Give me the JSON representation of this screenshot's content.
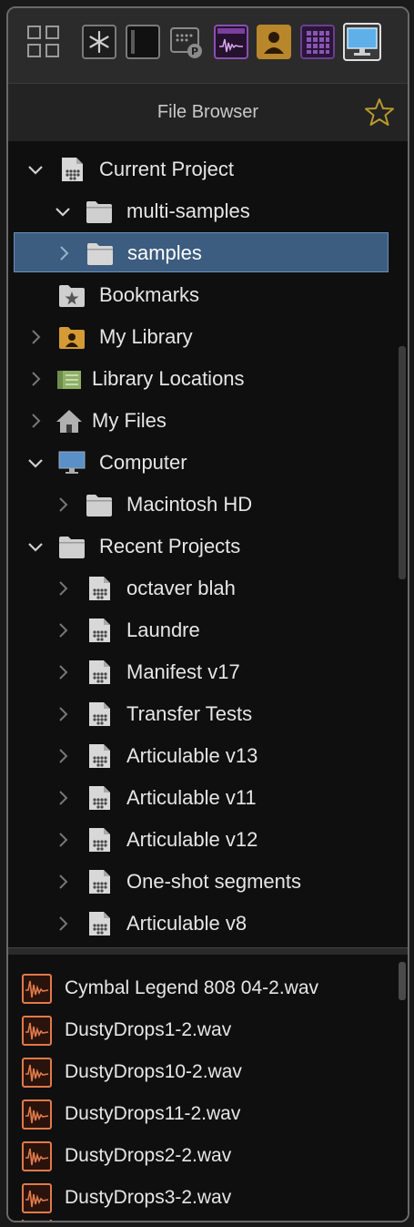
{
  "panel": {
    "title": "File Browser"
  },
  "toolbar": {
    "buttons": [
      {
        "name": "grid-icon"
      },
      {
        "name": "asterisk-icon"
      },
      {
        "name": "panel-icon"
      },
      {
        "name": "keypad-p-icon"
      },
      {
        "name": "waveform-icon"
      },
      {
        "name": "user-icon"
      },
      {
        "name": "pad-grid-icon"
      },
      {
        "name": "monitor-icon"
      }
    ]
  },
  "tree": {
    "items": [
      {
        "label": "Current Project",
        "level": 0,
        "expanded": true,
        "has_chevron": true,
        "icon": "project-icon"
      },
      {
        "label": "multi-samples",
        "level": 1,
        "expanded": true,
        "has_chevron": true,
        "icon": "folder-icon"
      },
      {
        "label": "samples",
        "level": 1,
        "expanded": false,
        "has_chevron": true,
        "icon": "folder-icon",
        "selected": true
      },
      {
        "label": "Bookmarks",
        "level": 0,
        "has_chevron": false,
        "icon": "bookmark-folder-icon"
      },
      {
        "label": "My Library",
        "level": 0,
        "expanded": false,
        "has_chevron": true,
        "icon": "library-user-icon"
      },
      {
        "label": "Library Locations",
        "level": 0,
        "expanded": false,
        "has_chevron": true,
        "icon": "library-locations-icon"
      },
      {
        "label": "My Files",
        "level": 0,
        "expanded": false,
        "has_chevron": true,
        "icon": "home-icon"
      },
      {
        "label": "Computer",
        "level": 0,
        "expanded": true,
        "has_chevron": true,
        "icon": "monitor-icon"
      },
      {
        "label": "Macintosh HD",
        "level": 1,
        "expanded": false,
        "has_chevron": true,
        "icon": "folder-icon"
      },
      {
        "label": "Recent Projects",
        "level": 0,
        "expanded": true,
        "has_chevron": true,
        "icon": "folder-icon"
      },
      {
        "label": "octaver blah",
        "level": 1,
        "expanded": false,
        "has_chevron": true,
        "icon": "project-icon"
      },
      {
        "label": "Laundre",
        "level": 1,
        "expanded": false,
        "has_chevron": true,
        "icon": "project-icon"
      },
      {
        "label": "Manifest v17",
        "level": 1,
        "expanded": false,
        "has_chevron": true,
        "icon": "project-icon"
      },
      {
        "label": "Transfer Tests",
        "level": 1,
        "expanded": false,
        "has_chevron": true,
        "icon": "project-icon"
      },
      {
        "label": "Articulable v13",
        "level": 1,
        "expanded": false,
        "has_chevron": true,
        "icon": "project-icon"
      },
      {
        "label": "Articulable v11",
        "level": 1,
        "expanded": false,
        "has_chevron": true,
        "icon": "project-icon"
      },
      {
        "label": "Articulable v12",
        "level": 1,
        "expanded": false,
        "has_chevron": true,
        "icon": "project-icon"
      },
      {
        "label": "One-shot segments",
        "level": 1,
        "expanded": false,
        "has_chevron": true,
        "icon": "project-icon"
      },
      {
        "label": "Articulable v8",
        "level": 1,
        "expanded": false,
        "has_chevron": true,
        "icon": "project-icon"
      }
    ]
  },
  "files": {
    "items": [
      {
        "label": "Cymbal Legend 808 04-2.wav",
        "icon": "audio-file-icon"
      },
      {
        "label": "DustyDrops1-2.wav",
        "icon": "audio-file-icon"
      },
      {
        "label": "DustyDrops10-2.wav",
        "icon": "audio-file-icon"
      },
      {
        "label": "DustyDrops11-2.wav",
        "icon": "audio-file-icon"
      },
      {
        "label": "DustyDrops2-2.wav",
        "icon": "audio-file-icon"
      },
      {
        "label": "DustyDrops3-2.wav",
        "icon": "audio-file-icon"
      }
    ]
  },
  "colors": {
    "selection": "#3c5d80",
    "audio_accent": "#e07a4a",
    "star": "#b99a2e"
  }
}
